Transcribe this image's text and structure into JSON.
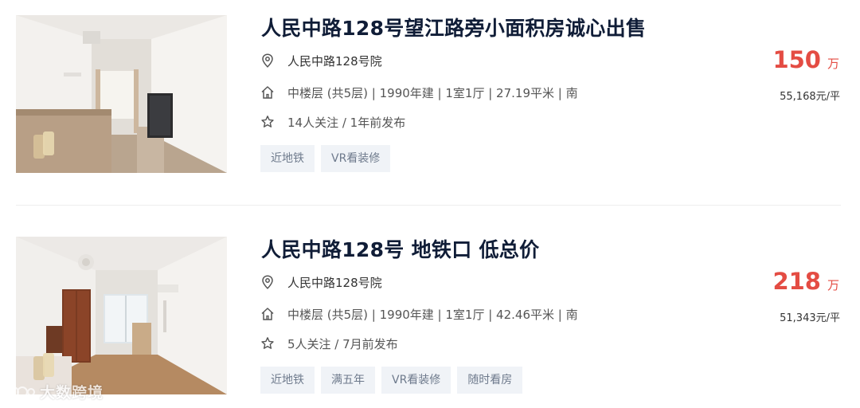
{
  "listings": [
    {
      "title": "人民中路128号望江路旁小面积房诚心出售",
      "address": "人民中路128号院",
      "info": "中楼层 (共5层) | 1990年建 | 1室1厅 | 27.19平米 | 南",
      "follow": "14人关注 / 1年前发布",
      "tags": [
        "近地铁",
        "VR看装修"
      ],
      "price": "150",
      "price_unit": "万",
      "unit_price": "55,168元/平"
    },
    {
      "title": "人民中路128号 地铁口 低总价",
      "address": "人民中路128号院",
      "info": "中楼层 (共5层) | 1990年建 | 1室1厅 | 42.46平米 | 南",
      "follow": "5人关注 / 7月前发布",
      "tags": [
        "近地铁",
        "满五年",
        "VR看装修",
        "随时看房"
      ],
      "price": "218",
      "price_unit": "万",
      "unit_price": "51,343元/平"
    }
  ],
  "icons": {
    "address": "location-pin-icon",
    "info": "house-icon",
    "follow": "star-icon"
  },
  "colors": {
    "price": "#e44c43",
    "title": "#101d37",
    "tag_bg": "#f0f3f7",
    "tag_text": "#6e7a8c"
  },
  "watermark": "大数跨境"
}
